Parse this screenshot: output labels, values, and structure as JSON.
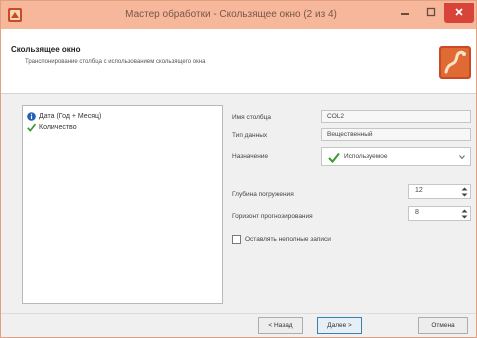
{
  "window": {
    "title": "Мастер обработки - Скользящее окно (2 из 4)",
    "icons": {
      "app": "app-icon",
      "minimize": "minimize-icon",
      "maximize": "maximize-icon",
      "close": "close-icon"
    }
  },
  "header": {
    "title": "Скользящее окно",
    "description": "Транспонирование столбца с использованием скользящего окна",
    "logo": "wizard-logo-icon"
  },
  "columns_list": [
    {
      "label": "Дата (Год + Месяц)",
      "icon": "info-icon"
    },
    {
      "label": "Количество",
      "icon": "checkmark-icon"
    }
  ],
  "properties": {
    "column_name_label": "Имя столбца",
    "column_name_value": "COL2",
    "data_type_label": "Тип данных",
    "data_type_value": "Вещественный",
    "purpose_label": "Назначение",
    "purpose_value": "Используемое"
  },
  "settings": {
    "depth_label": "Глубина погружения",
    "depth_value": "12",
    "horizon_label": "Горизонт прогнозирования",
    "horizon_value": "8",
    "keep_rows_label": "Оставлять неполные записи",
    "keep_rows_checked": false
  },
  "buttons": {
    "back": "< Назад",
    "next": "Далее >",
    "cancel": "Отмена"
  },
  "colors": {
    "titlebar": "#f6b79b",
    "close_button": "#d8433a",
    "info_icon": "#1f5fb3",
    "check_icon": "#3a9b2c",
    "logo_bg": "#c94a24"
  }
}
